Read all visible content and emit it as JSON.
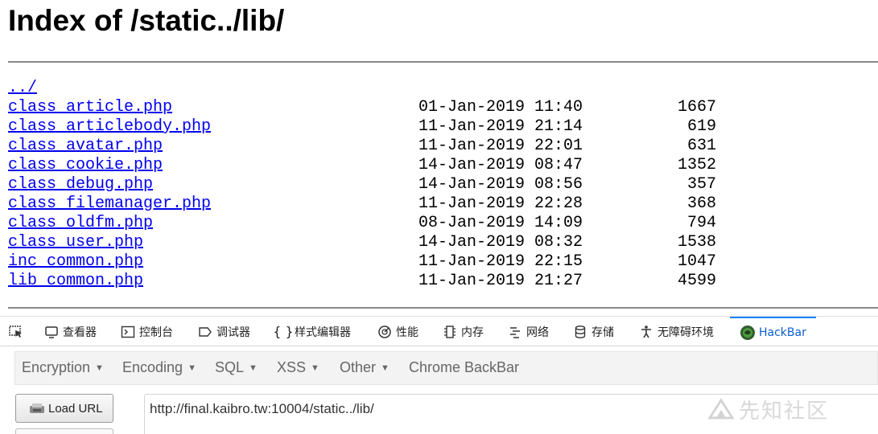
{
  "page_title": "Index of /static../lib/",
  "parent_link": "../",
  "files": [
    {
      "name": "class_article.php",
      "date": "01-Jan-2019 11:40",
      "size": "1667"
    },
    {
      "name": "class_articlebody.php",
      "date": "11-Jan-2019 21:14",
      "size": "619"
    },
    {
      "name": "class_avatar.php",
      "date": "11-Jan-2019 22:01",
      "size": "631"
    },
    {
      "name": "class_cookie.php",
      "date": "14-Jan-2019 08:47",
      "size": "1352"
    },
    {
      "name": "class_debug.php",
      "date": "14-Jan-2019 08:56",
      "size": "357"
    },
    {
      "name": "class_filemanager.php",
      "date": "11-Jan-2019 22:28",
      "size": "368"
    },
    {
      "name": "class_oldfm.php",
      "date": "08-Jan-2019 14:09",
      "size": "794"
    },
    {
      "name": "class_user.php",
      "date": "14-Jan-2019 08:32",
      "size": "1538"
    },
    {
      "name": "inc_common.php",
      "date": "11-Jan-2019 22:15",
      "size": "1047"
    },
    {
      "name": "lib_common.php",
      "date": "11-Jan-2019 21:27",
      "size": "4599"
    }
  ],
  "devtools": {
    "picker_icon": "element-picker-icon",
    "tabs": [
      {
        "label": "查看器",
        "icon": "inspector-icon"
      },
      {
        "label": "控制台",
        "icon": "console-icon"
      },
      {
        "label": "调试器",
        "icon": "debugger-icon"
      },
      {
        "label": "样式编辑器",
        "icon": "style-editor-icon"
      },
      {
        "label": "性能",
        "icon": "performance-icon"
      },
      {
        "label": "内存",
        "icon": "memory-icon"
      },
      {
        "label": "网络",
        "icon": "network-icon"
      },
      {
        "label": "存储",
        "icon": "storage-icon"
      },
      {
        "label": "无障碍环境",
        "icon": "accessibility-icon"
      },
      {
        "label": "HackBar",
        "icon": "hackbar-icon",
        "active": true
      }
    ],
    "accent_color": "#0a84ff"
  },
  "hackbar": {
    "menus": [
      {
        "label": "Encryption",
        "has_dropdown": true
      },
      {
        "label": "Encoding",
        "has_dropdown": true
      },
      {
        "label": "SQL",
        "has_dropdown": true
      },
      {
        "label": "XSS",
        "has_dropdown": true
      },
      {
        "label": "Other",
        "has_dropdown": true
      },
      {
        "label": "Chrome BackBar",
        "has_dropdown": false
      }
    ],
    "load_url_label": "Load URL",
    "url_value": "http://final.kaibro.tw:10004/static../lib/"
  },
  "watermark": "先知社区",
  "link_color": "#0000ee"
}
